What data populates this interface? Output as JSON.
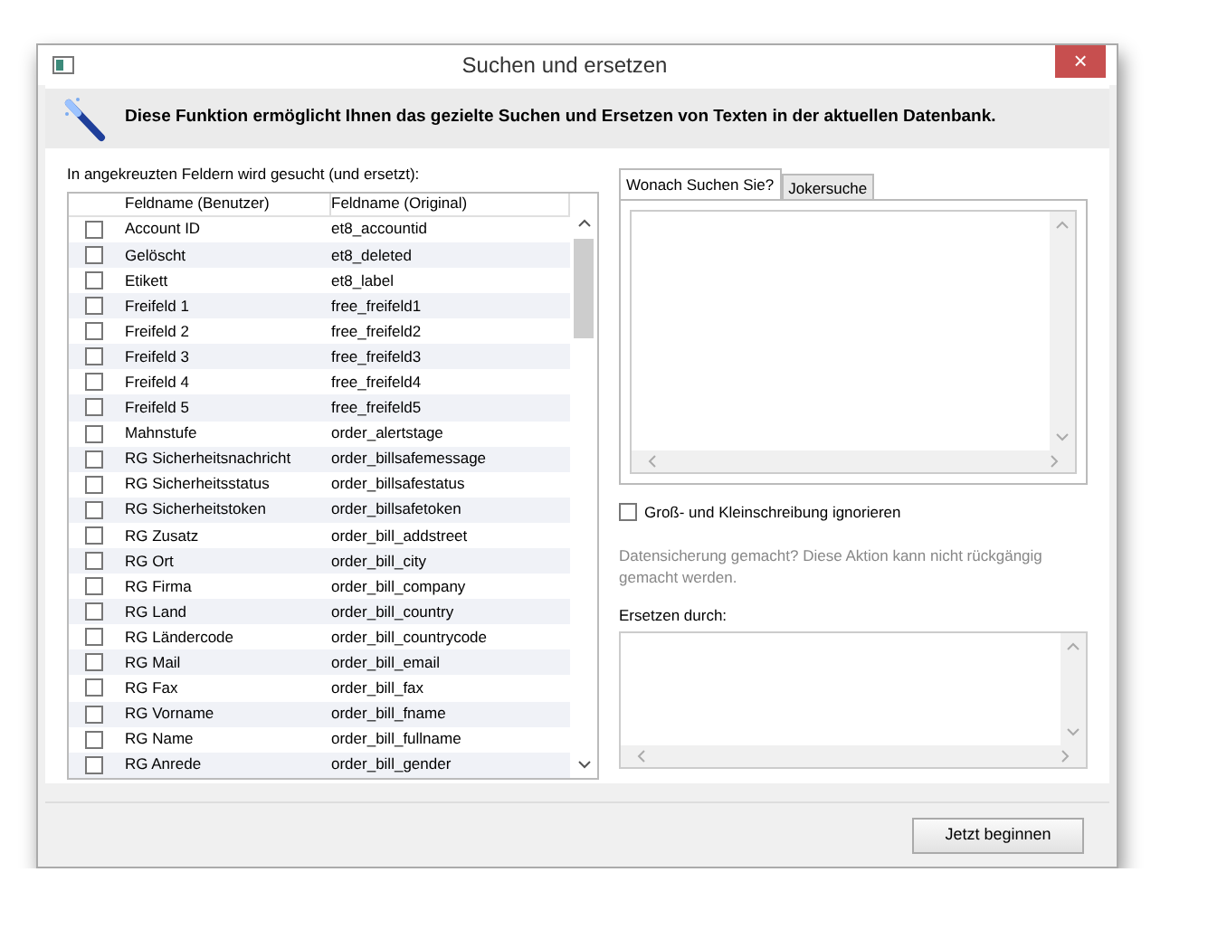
{
  "window": {
    "title": "Suchen und ersetzen",
    "close": "×"
  },
  "header": {
    "text": "Diese Funktion ermöglicht Ihnen das gezielte Suchen und Ersetzen von Texten in der aktuellen Datenbank."
  },
  "fields_label": "In angekreuzten Feldern wird gesucht (und ersetzt):",
  "table": {
    "columns": [
      "Feldname (Benutzer)",
      "Feldname (Original)"
    ],
    "rows": [
      {
        "user": "Account ID",
        "original": "et8_accountid",
        "checked": false
      },
      {
        "user": "Gelöscht",
        "original": "et8_deleted",
        "checked": false
      },
      {
        "user": "Etikett",
        "original": "et8_label",
        "checked": false
      },
      {
        "user": "Freifeld 1",
        "original": "free_freifeld1",
        "checked": false
      },
      {
        "user": "Freifeld 2",
        "original": "free_freifeld2",
        "checked": false
      },
      {
        "user": "Freifeld 3",
        "original": "free_freifeld3",
        "checked": false
      },
      {
        "user": "Freifeld 4",
        "original": "free_freifeld4",
        "checked": false
      },
      {
        "user": "Freifeld 5",
        "original": "free_freifeld5",
        "checked": false
      },
      {
        "user": "Mahnstufe",
        "original": "order_alertstage",
        "checked": false
      },
      {
        "user": "RG Sicherheitsnachricht",
        "original": "order_billsafemessage",
        "checked": false
      },
      {
        "user": "RG Sicherheitsstatus",
        "original": "order_billsafestatus",
        "checked": false
      },
      {
        "user": "RG Sicherheitstoken",
        "original": "order_billsafetoken",
        "checked": false
      },
      {
        "user": "RG Zusatz",
        "original": "order_bill_addstreet",
        "checked": false
      },
      {
        "user": "RG Ort",
        "original": "order_bill_city",
        "checked": false
      },
      {
        "user": "RG Firma",
        "original": "order_bill_company",
        "checked": false
      },
      {
        "user": "RG Land",
        "original": "order_bill_country",
        "checked": false
      },
      {
        "user": "RG Ländercode",
        "original": "order_bill_countrycode",
        "checked": false
      },
      {
        "user": "RG Mail",
        "original": "order_bill_email",
        "checked": false
      },
      {
        "user": "RG Fax",
        "original": "order_bill_fax",
        "checked": false
      },
      {
        "user": "RG Vorname",
        "original": "order_bill_fname",
        "checked": false
      },
      {
        "user": "RG Name",
        "original": "order_bill_fullname",
        "checked": false
      },
      {
        "user": "RG Anrede",
        "original": "order_bill_gender",
        "checked": false
      }
    ]
  },
  "tabs": [
    {
      "label": "Wonach Suchen Sie?",
      "selected": true
    },
    {
      "label": "Jokersuche",
      "selected": false
    }
  ],
  "ignore_case": {
    "label": "Groß- und Kleinschreibung ignorieren",
    "checked": false
  },
  "warning": "Datensicherung gemacht? Diese Aktion kann nicht rückgängig gemacht werden.",
  "replace_label": "Ersetzen durch:",
  "start_button": "Jetzt beginnen"
}
